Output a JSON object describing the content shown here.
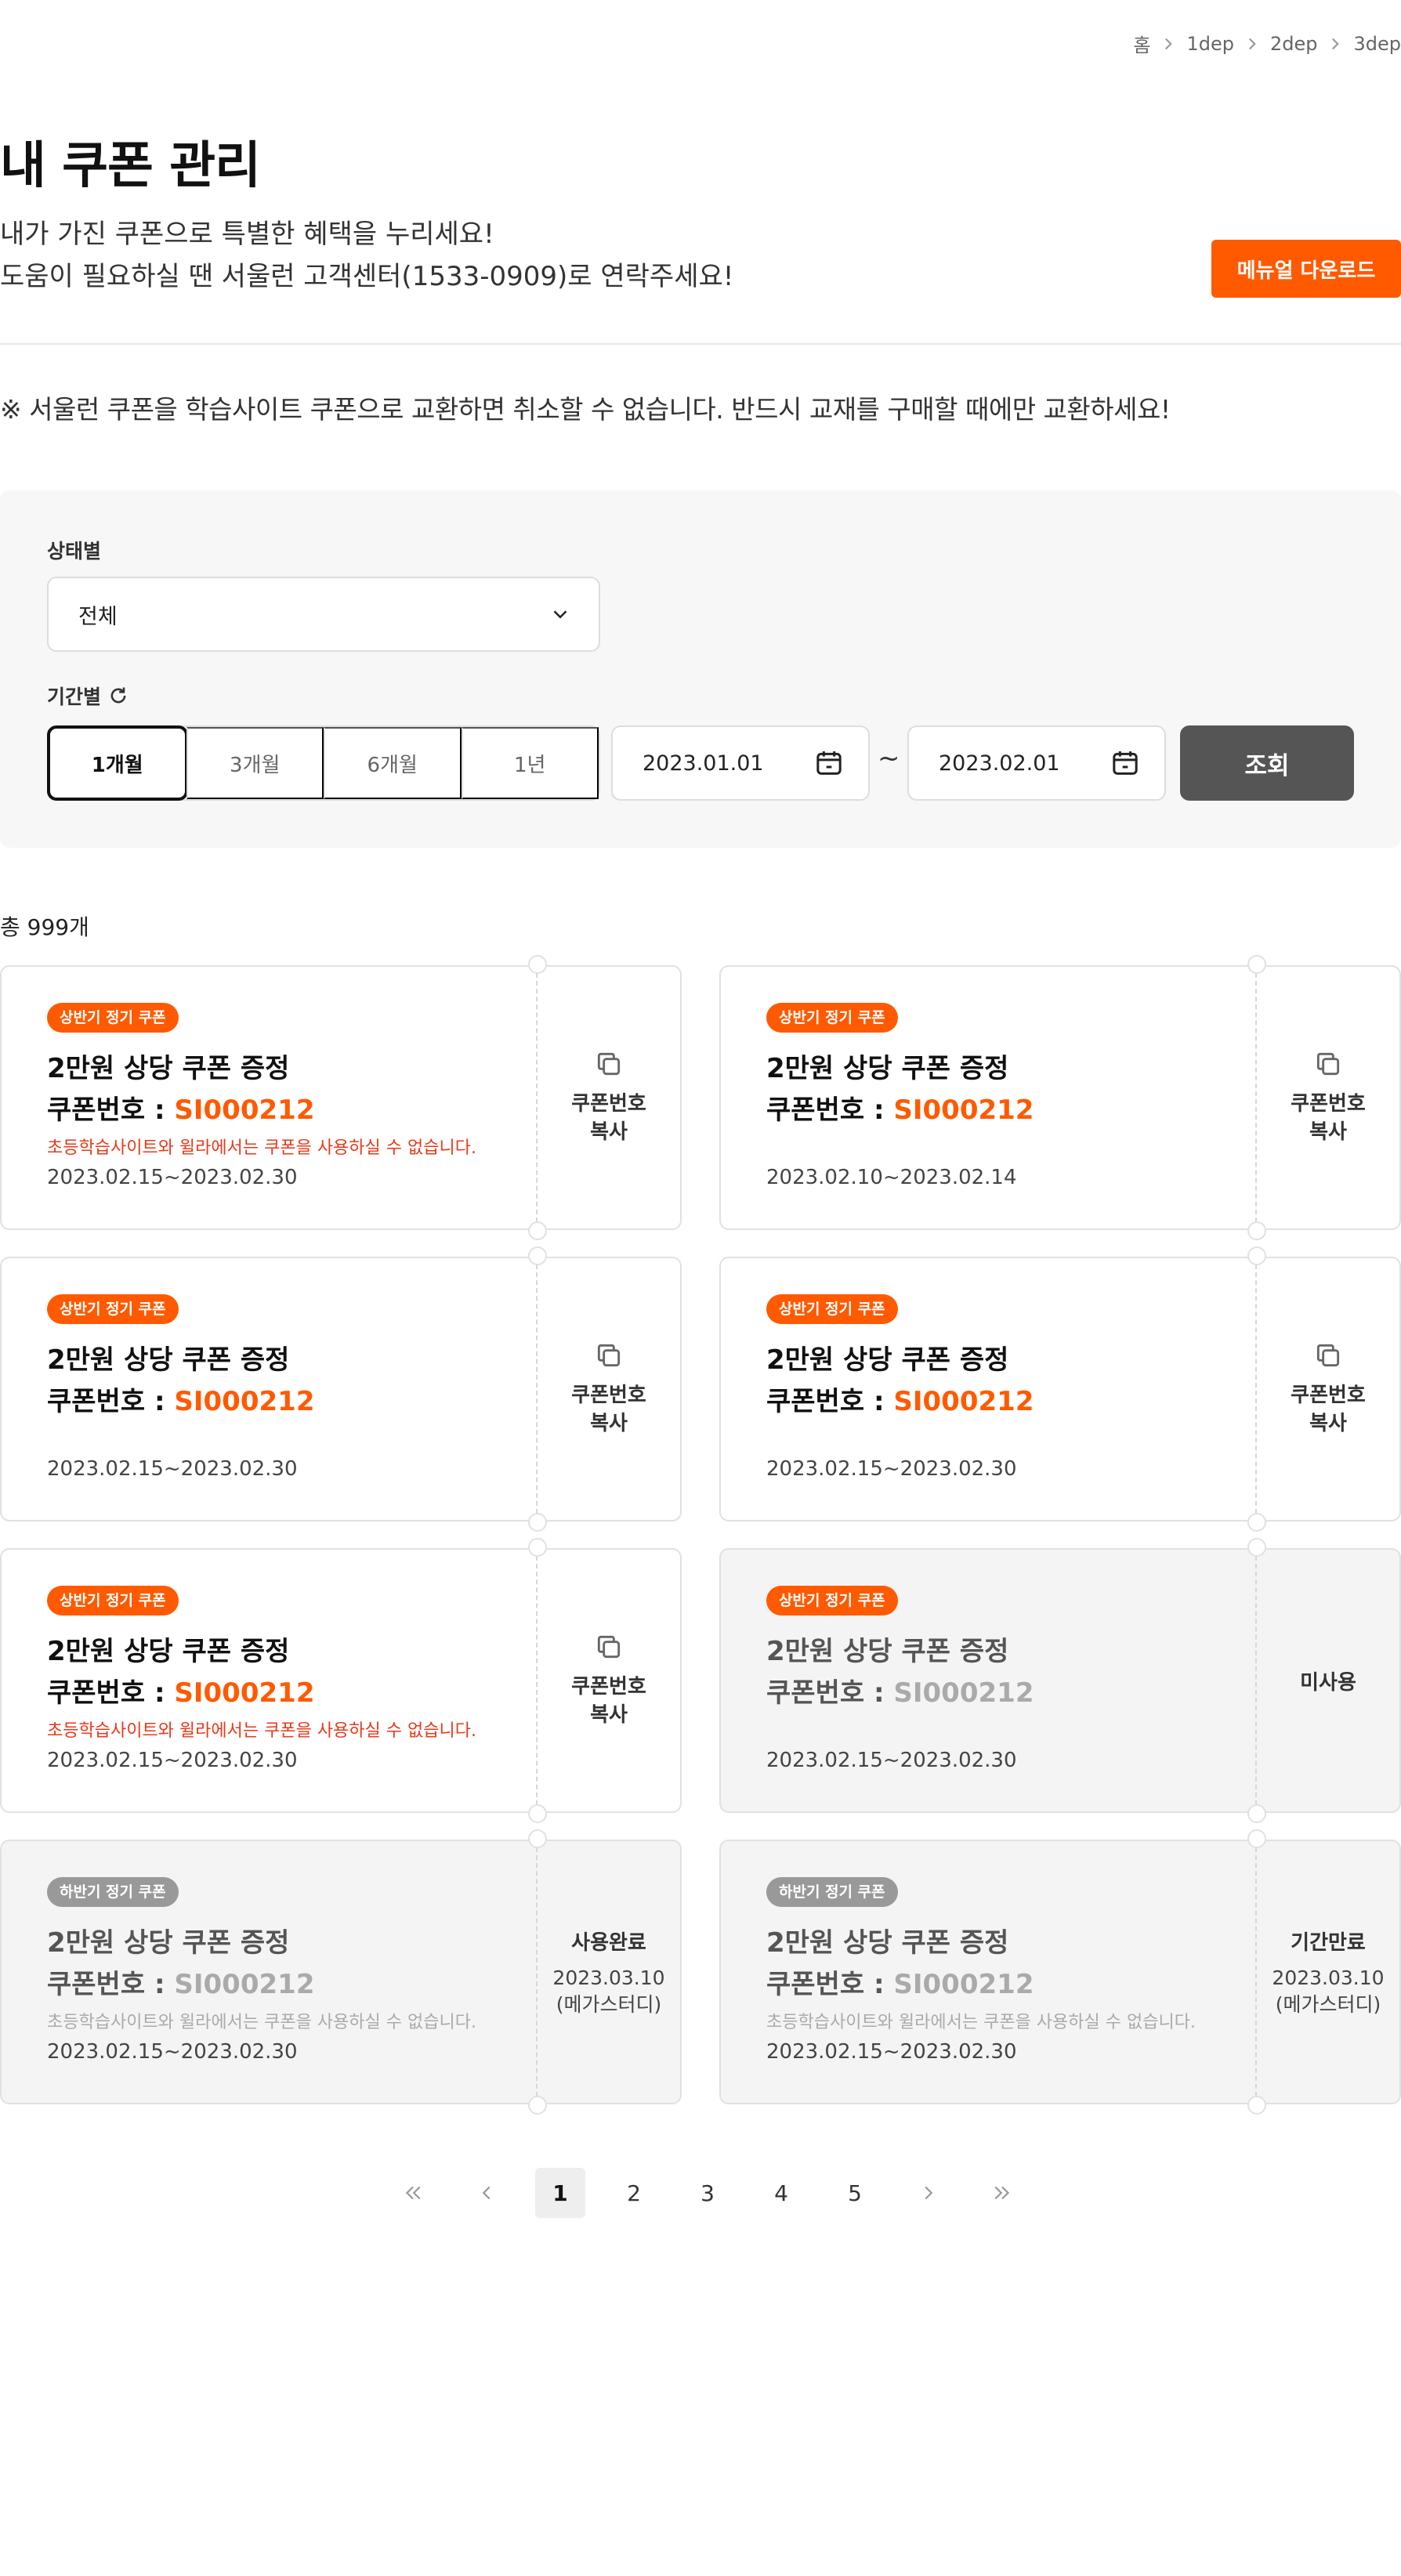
{
  "breadcrumb": [
    "홈",
    "1dep",
    "2dep",
    "3dep"
  ],
  "page": {
    "title": "내 쿠폰 관리",
    "intro_line1": "내가 가진 쿠폰으로 특별한 혜택을 누리세요!",
    "intro_line2": "도움이 필요하실 땐 서울런 고객센터(1533-0909)로 연락주세요!",
    "manual_button": "메뉴얼 다운로드",
    "notice": "※ 서울런 쿠폰을 학습사이트 쿠폰으로 교환하면 취소할 수 없습니다. 반드시 교재를 구매할 때에만 교환하세요!"
  },
  "filter": {
    "status_label": "상태별",
    "status_value": "전체",
    "period_label": "기간별",
    "periods": [
      "1개월",
      "3개월",
      "6개월",
      "1년"
    ],
    "active_period": "1개월",
    "date_from": "2023.01.01",
    "date_tilde": "~",
    "date_to": "2023.02.01",
    "search_button": "조회"
  },
  "total": "총 999개",
  "coupons": [
    {
      "badge": "상반기 정기 쿠폰",
      "title": "2만원 상당 쿠폰 증정",
      "code_label": "쿠폰번호 : ",
      "code": "SI000212",
      "warning": "초등학습사이트와 윌라에서는 쿠폰을 사용하실 수 없습니다.",
      "date": "2023.02.15~2023.02.30",
      "action_line1": "쿠폰번호",
      "action_line2": "복사"
    },
    {
      "badge": "상반기 정기 쿠폰",
      "title": "2만원 상당 쿠폰 증정",
      "code_label": "쿠폰번호 : ",
      "code": "SI000212",
      "warning": "",
      "date": "2023.02.10~2023.02.14",
      "action_line1": "쿠폰번호",
      "action_line2": "복사"
    },
    {
      "badge": "상반기 정기 쿠폰",
      "title": "2만원 상당 쿠폰 증정",
      "code_label": "쿠폰번호 : ",
      "code": "SI000212",
      "warning": "",
      "date": "2023.02.15~2023.02.30",
      "action_line1": "쿠폰번호",
      "action_line2": "복사"
    },
    {
      "badge": "상반기 정기 쿠폰",
      "title": "2만원 상당 쿠폰 증정",
      "code_label": "쿠폰번호 : ",
      "code": "SI000212",
      "warning": "",
      "date": "2023.02.15~2023.02.30",
      "action_line1": "쿠폰번호",
      "action_line2": "복사"
    },
    {
      "badge": "상반기 정기 쿠폰",
      "title": "2만원 상당 쿠폰 증정",
      "code_label": "쿠폰번호 : ",
      "code": "SI000212",
      "warning": "초등학습사이트와 윌라에서는 쿠폰을 사용하실 수 없습니다.",
      "date": "2023.02.15~2023.02.30",
      "action_line1": "쿠폰번호",
      "action_line2": "복사"
    },
    {
      "badge": "상반기 정기 쿠폰",
      "title": "2만원 상당 쿠폰 증정",
      "code_label": "쿠폰번호 : ",
      "code": "SI000212",
      "warning": "",
      "date": "2023.02.15~2023.02.30",
      "status": "미사용"
    },
    {
      "badge": "하반기 정기 쿠폰",
      "title": "2만원 상당 쿠폰 증정",
      "code_label": "쿠폰번호 : ",
      "code": "SI000212",
      "warning": "초등학습사이트와 윌라에서는 쿠폰을 사용하실 수 없습니다.",
      "date": "2023.02.15~2023.02.30",
      "status": "사용완료",
      "status_date": "2023.03.10",
      "status_site": "(메가스터디)"
    },
    {
      "badge": "하반기 정기 쿠폰",
      "title": "2만원 상당 쿠폰 증정",
      "code_label": "쿠폰번호 : ",
      "code": "SI000212",
      "warning": "초등학습사이트와 윌라에서는 쿠폰을 사용하실 수 없습니다.",
      "date": "2023.02.15~2023.02.30",
      "status": "기간만료",
      "status_date": "2023.03.10",
      "status_site": "(메가스터디)"
    }
  ],
  "pagination": {
    "pages": [
      "1",
      "2",
      "3",
      "4",
      "5"
    ],
    "current": "1"
  },
  "colors": {
    "accent": "#ff5a00",
    "warning": "#e8391a",
    "dark_button": "#555555",
    "panel_bg": "#f7f7f7",
    "muted_card": "#f4f4f4"
  },
  "icons": {
    "breadcrumb_separator": "chevron-right-icon",
    "status_select": "chevron-down-icon",
    "period_reset": "refresh-icon",
    "date": "calendar-icon",
    "copy": "copy-icon",
    "first": "double-chevron-left-icon",
    "prev": "chevron-left-icon",
    "next": "chevron-right-icon",
    "last": "double-chevron-right-icon"
  }
}
